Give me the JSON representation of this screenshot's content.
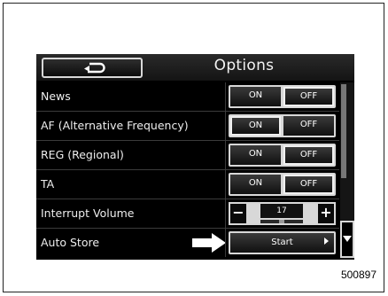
{
  "header": {
    "title": "Options"
  },
  "rows": [
    {
      "label": "News",
      "control": "onoff",
      "on": "ON",
      "off": "OFF",
      "selected": "off"
    },
    {
      "label": "AF (Alternative Frequency)",
      "control": "onoff",
      "on": "ON",
      "off": "OFF",
      "selected": "on"
    },
    {
      "label": "REG (Regional)",
      "control": "onoff",
      "on": "ON",
      "off": "OFF",
      "selected": "off"
    },
    {
      "label": "TA",
      "control": "onoff",
      "on": "ON",
      "off": "OFF",
      "selected": "off"
    },
    {
      "label": "Interrupt Volume",
      "control": "stepper",
      "minus": "−",
      "plus": "+",
      "value": "17",
      "level_fraction": 0.5
    },
    {
      "label": "Auto Store",
      "control": "button",
      "button_label": "Start"
    }
  ],
  "caption": "500897",
  "icons": {
    "back": "back-arrow-icon",
    "scroll_down": "chevron-down-icon",
    "pointer": "pointer-arrow-icon",
    "start": "play-triangle-icon"
  },
  "colors": {
    "background": "#000000",
    "button_border": "#d8d8d8",
    "text": "#eeeeee"
  }
}
